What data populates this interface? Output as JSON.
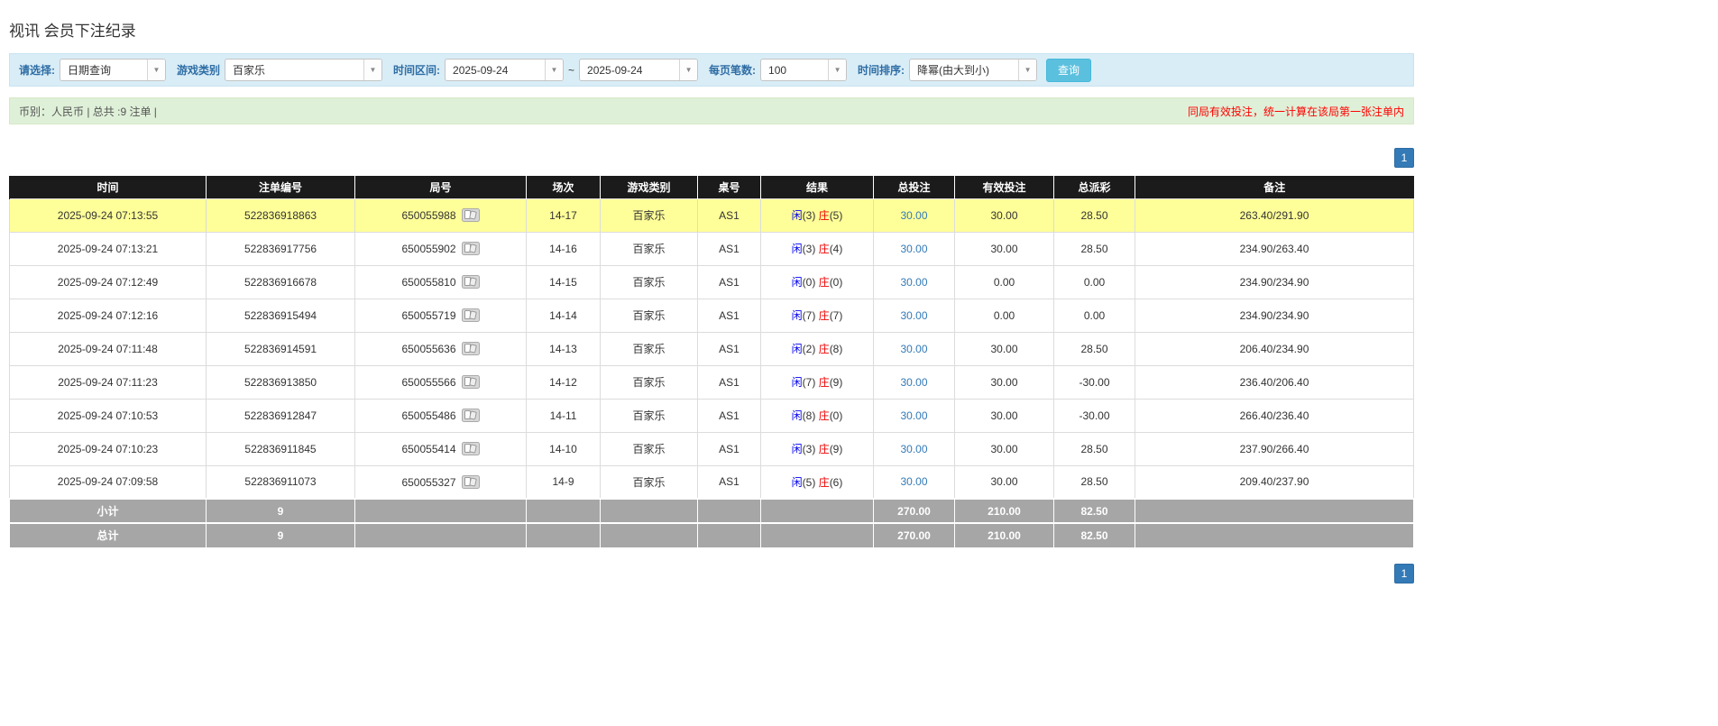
{
  "page": {
    "title": "视讯 会员下注纪录"
  },
  "filters": {
    "label_select": "请选择:",
    "select_type": "日期查询",
    "label_game_type": "游戏类别",
    "game_type": "百家乐",
    "label_time_range": "时间区间:",
    "date_from": "2025-09-24",
    "range_separator": "~",
    "date_to": "2025-09-24",
    "label_page_size": "每页笔数:",
    "page_size": "100",
    "label_sort": "时间排序:",
    "sort_order": "降幂(由大到小)",
    "search_button": "查询"
  },
  "summary": {
    "info": "币别：人民币 | 总共 :9 注单 |",
    "notice": "同局有效投注，统一计算在该局第一张注单内"
  },
  "pagination": {
    "current_page": "1"
  },
  "icons": {
    "combo_arrow": "chevron-down-icon",
    "round_action": "video-replay-icon"
  },
  "colors": {
    "accent_blue": "#337ab7",
    "filter_bar_blue": "#d9edf7",
    "summary_green": "#dff0d8",
    "header_black": "#1b1b1b",
    "highlight_yellow": "#ffff99",
    "player_blue": "#0000ee",
    "banker_red": "#ee0000",
    "negative_red": "#ff0000"
  },
  "table": {
    "headers": [
      "时间",
      "注单编号",
      "局号",
      "场次",
      "游戏类别",
      "桌号",
      "结果",
      "总投注",
      "有效投注",
      "总派彩",
      "备注"
    ],
    "rows": [
      {
        "time": "2025-09-24 07:13:55",
        "bet_id": "522836918863",
        "round_no": "650055988",
        "session": "14-17",
        "game_type": "百家乐",
        "table_no": "AS1",
        "player": "闲",
        "player_score": "(3)",
        "banker": "庄",
        "banker_score": "(5)",
        "total_bet": "30.00",
        "valid_bet": "30.00",
        "payout": "28.50",
        "remark": "263.40/291.90",
        "highlight": true
      },
      {
        "time": "2025-09-24 07:13:21",
        "bet_id": "522836917756",
        "round_no": "650055902",
        "session": "14-16",
        "game_type": "百家乐",
        "table_no": "AS1",
        "player": "闲",
        "player_score": "(3)",
        "banker": "庄",
        "banker_score": "(4)",
        "total_bet": "30.00",
        "valid_bet": "30.00",
        "payout": "28.50",
        "remark": "234.90/263.40",
        "highlight": false
      },
      {
        "time": "2025-09-24 07:12:49",
        "bet_id": "522836916678",
        "round_no": "650055810",
        "session": "14-15",
        "game_type": "百家乐",
        "table_no": "AS1",
        "player": "闲",
        "player_score": "(0)",
        "banker": "庄",
        "banker_score": "(0)",
        "total_bet": "30.00",
        "valid_bet": "0.00",
        "payout": "0.00",
        "remark": "234.90/234.90",
        "highlight": false
      },
      {
        "time": "2025-09-24 07:12:16",
        "bet_id": "522836915494",
        "round_no": "650055719",
        "session": "14-14",
        "game_type": "百家乐",
        "table_no": "AS1",
        "player": "闲",
        "player_score": "(7)",
        "banker": "庄",
        "banker_score": "(7)",
        "total_bet": "30.00",
        "valid_bet": "0.00",
        "payout": "0.00",
        "remark": "234.90/234.90",
        "highlight": false
      },
      {
        "time": "2025-09-24 07:11:48",
        "bet_id": "522836914591",
        "round_no": "650055636",
        "session": "14-13",
        "game_type": "百家乐",
        "table_no": "AS1",
        "player": "闲",
        "player_score": "(2)",
        "banker": "庄",
        "banker_score": "(8)",
        "total_bet": "30.00",
        "valid_bet": "30.00",
        "payout": "28.50",
        "remark": "206.40/234.90",
        "highlight": false
      },
      {
        "time": "2025-09-24 07:11:23",
        "bet_id": "522836913850",
        "round_no": "650055566",
        "session": "14-12",
        "game_type": "百家乐",
        "table_no": "AS1",
        "player": "闲",
        "player_score": "(7)",
        "banker": "庄",
        "banker_score": "(9)",
        "total_bet": "30.00",
        "valid_bet": "30.00",
        "payout": "-30.00",
        "remark": "236.40/206.40",
        "highlight": false
      },
      {
        "time": "2025-09-24 07:10:53",
        "bet_id": "522836912847",
        "round_no": "650055486",
        "session": "14-11",
        "game_type": "百家乐",
        "table_no": "AS1",
        "player": "闲",
        "player_score": "(8)",
        "banker": "庄",
        "banker_score": "(0)",
        "total_bet": "30.00",
        "valid_bet": "30.00",
        "payout": "-30.00",
        "remark": "266.40/236.40",
        "highlight": false
      },
      {
        "time": "2025-09-24 07:10:23",
        "bet_id": "522836911845",
        "round_no": "650055414",
        "session": "14-10",
        "game_type": "百家乐",
        "table_no": "AS1",
        "player": "闲",
        "player_score": "(3)",
        "banker": "庄",
        "banker_score": "(9)",
        "total_bet": "30.00",
        "valid_bet": "30.00",
        "payout": "28.50",
        "remark": "237.90/266.40",
        "highlight": false
      },
      {
        "time": "2025-09-24 07:09:58",
        "bet_id": "522836911073",
        "round_no": "650055327",
        "session": "14-9",
        "game_type": "百家乐",
        "table_no": "AS1",
        "player": "闲",
        "player_score": "(5)",
        "banker": "庄",
        "banker_score": "(6)",
        "total_bet": "30.00",
        "valid_bet": "30.00",
        "payout": "28.50",
        "remark": "209.40/237.90",
        "highlight": false
      }
    ],
    "footer": [
      {
        "label": "小计",
        "count": "9",
        "total_bet": "270.00",
        "valid_bet": "210.00",
        "payout": "82.50"
      },
      {
        "label": "总计",
        "count": "9",
        "total_bet": "270.00",
        "valid_bet": "210.00",
        "payout": "82.50"
      }
    ]
  }
}
